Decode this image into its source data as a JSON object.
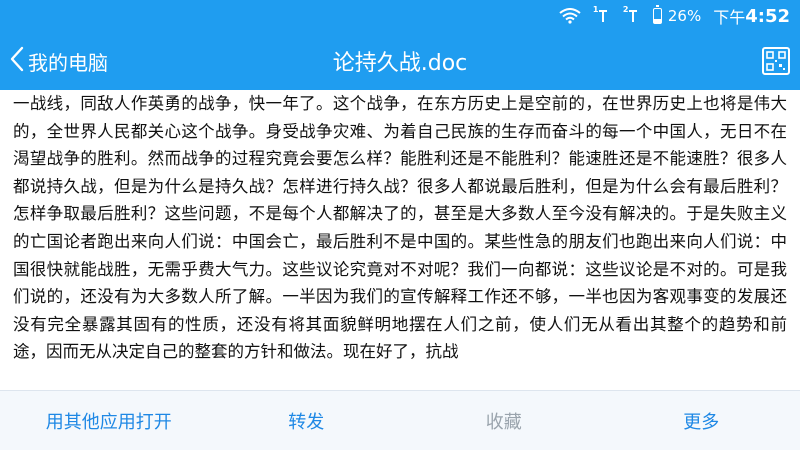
{
  "status_bar": {
    "wifi_icon": "wifi-icon",
    "sim1_label": "1",
    "sim2_label": "2",
    "battery_percent": "26%",
    "battery_level": 0.26,
    "time_prefix": "下午",
    "time_value": "4:52"
  },
  "header": {
    "back_label": "我的电脑",
    "title": "论持久战.doc",
    "qr_icon": "qr-scan-icon"
  },
  "document": {
    "text": "一战线，同敌人作英勇的战争，快一年了。这个战争，在东方历史上是空前的，在世界历史上也将是伟大的，全世界人民都关心这个战争。身受战争灾难、为着自己民族的生存而奋斗的每一个中国人，无日不在渴望战争的胜利。然而战争的过程究竟会要怎么样？能胜利还是不能胜利？能速胜还是不能速胜？很多人都说持久战，但是为什么是持久战？怎样进行持久战？很多人都说最后胜利，但是为什么会有最后胜利？怎样争取最后胜利？这些问题，不是每个人都解决了的，甚至是大多数人至今没有解决的。于是失败主义的亡国论者跑出来向人们说：中国会亡，最后胜利不是中国的。某些性急的朋友们也跑出来向人们说：中国很快就能战胜，无需乎费大气力。这些议论究竟对不对呢？我们一向都说：这些议论是不对的。可是我们说的，还没有为大多数人所了解。一半因为我们的宣传解释工作还不够，一半也因为客观事变的发展还没有完全暴露其固有的性质，还没有将其面貌鲜明地摆在人们之前，使人们无从看出其整个的趋势和前途，因而无从决定自己的整套的方针和做法。现在好了，抗战"
  },
  "bottom_bar": {
    "open_with": "用其他应用打开",
    "forward": "转发",
    "favorite": "收藏",
    "more": "更多"
  }
}
